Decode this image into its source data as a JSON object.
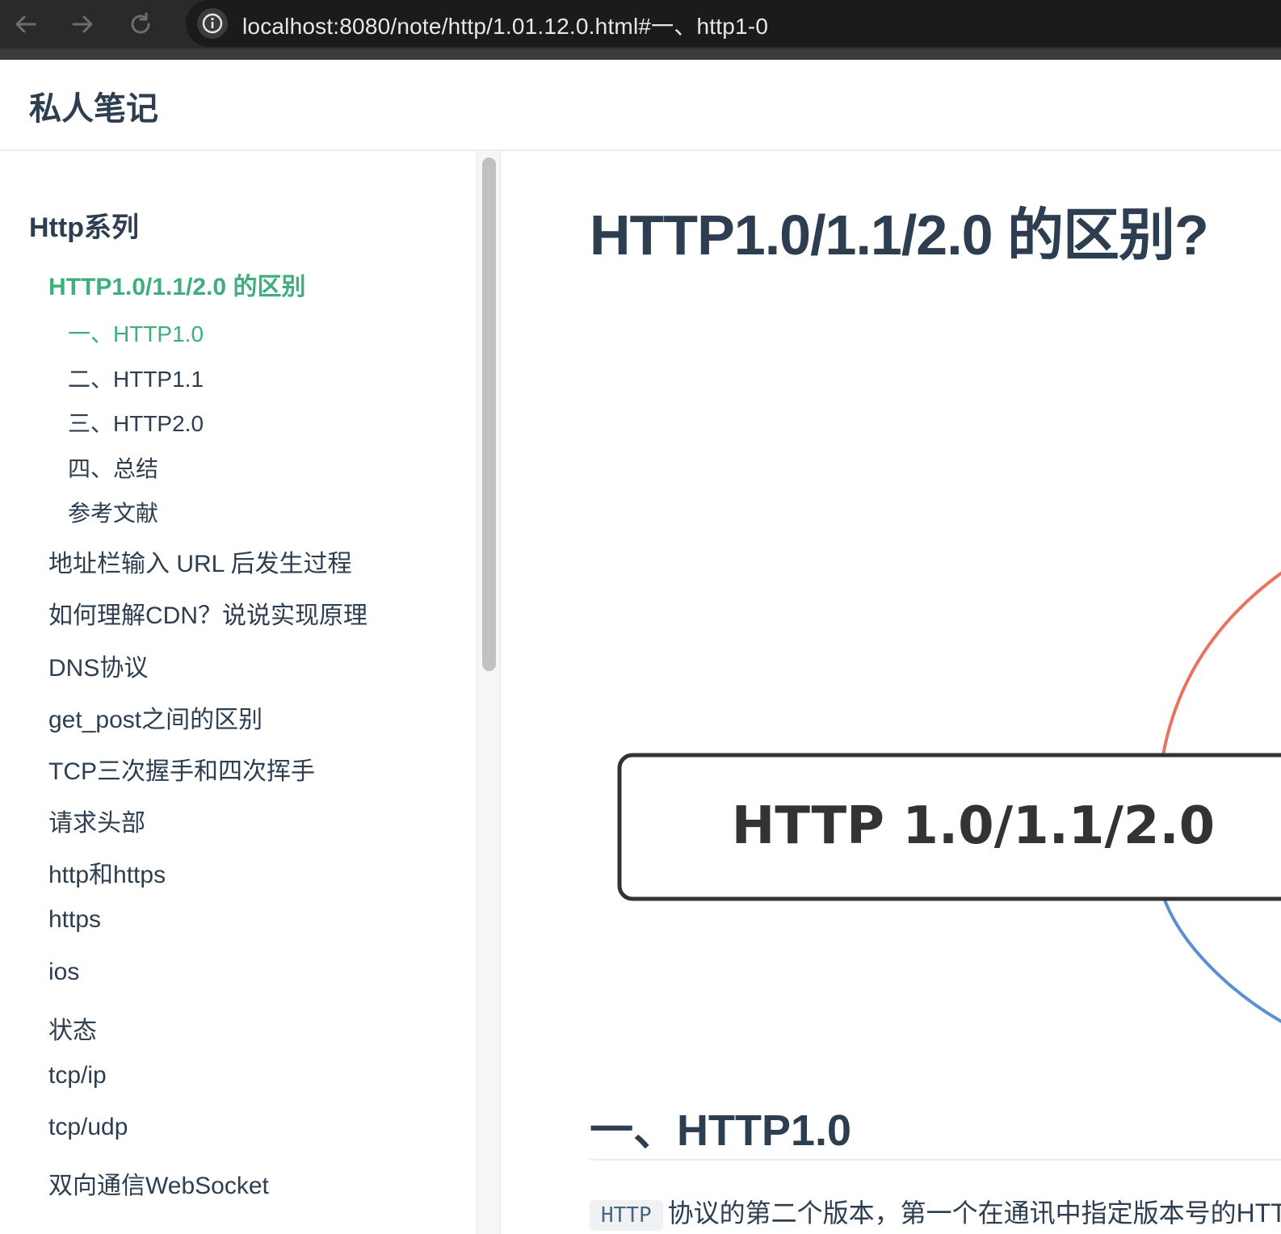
{
  "browser": {
    "url": "localhost:8080/note/http/1.01.12.0.html#一、http1-0",
    "icons": [
      "back-icon",
      "forward-icon",
      "reload-icon",
      "info-icon"
    ]
  },
  "site": {
    "title": "私人笔记"
  },
  "sidebar": {
    "group_title": "Http系列",
    "active_page": "HTTP1.0/1.1/2.0 的区别",
    "subsections": [
      "一、HTTP1.0",
      "二、HTTP1.1",
      "三、HTTP2.0",
      "四、总结",
      "参考文献"
    ],
    "links": [
      "地址栏输入 URL 后发生过程",
      "如何理解CDN？说说实现原理",
      "DNS协议",
      "get_post之间的区别",
      "TCP三次握手和四次挥手",
      "请求头部",
      "http和https",
      "https",
      "ios",
      "状态",
      "tcp/ip",
      "tcp/udp",
      "双向通信WebSocket"
    ]
  },
  "main": {
    "title": "HTTP1.0/1.1/2.0 的区别?",
    "mindmap_label": "HTTP 1.0/1.1/2.0",
    "section_heading": "一、HTTP1.0",
    "paragraph_code": "HTTP",
    "paragraph_text": "协议的第二个版本，第一个在通讯中指定版本号的HTTP"
  },
  "colors": {
    "accent": "#3eaf7c",
    "text": "#2c3e50",
    "mindmap_red": "#e8735f",
    "mindmap_blue": "#5a8fd6"
  }
}
